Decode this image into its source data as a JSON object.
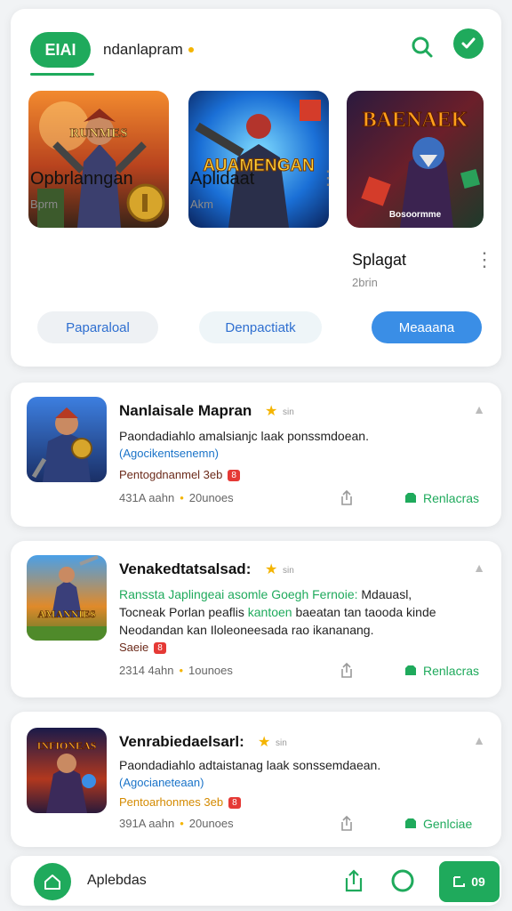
{
  "colors": {
    "accent": "#1faa5c",
    "blue": "#3a8ee6",
    "link": "#1a73c8",
    "star": "#f4b400",
    "badge": "#e53935"
  },
  "header": {
    "tab_label": "EIAI",
    "title": "ndanlapram"
  },
  "featured": [
    {
      "name": "Opbrlanngan",
      "size": "Bprm",
      "button": "Paparaloal",
      "art_text": "RUNMES"
    },
    {
      "name": "Aplidaat",
      "size": "Akm",
      "button": "Denpactiatk",
      "art_text": "AUAMENGAN"
    },
    {
      "name": "Splagat",
      "size": "2brin",
      "button": "Meaaana",
      "art_text": "BAENAEK",
      "art_subtext": "Bosoormme"
    }
  ],
  "list": [
    {
      "title": "Nanlaisale Mapran",
      "rating_small": "sin",
      "desc": "Paondadiahlo amalsianjc laak ponssmdoean.",
      "link": "(Agocikentsenemn)",
      "developer": "Pentogdnanmel 3eb",
      "badge": "8",
      "size": "431A aahn",
      "installs": "20unoes",
      "action": "Renlacras"
    },
    {
      "title": "Venakedtatsalsad:",
      "rating_small": "sin",
      "desc_line1_green": "Ranssta Japlingeai asomle Goegh Fernoie:",
      "desc_line1_rest": " Mdauasl,",
      "desc_line2_start": "Tocneak Porlan peaflis ",
      "desc_line2_green": "kantoen",
      "desc_line2_end": " baeatan tan taooda kinde",
      "desc_line3": "Neodandan kan Iloleoneesada rao ikananang.",
      "developer": "Saeie",
      "badge": "8",
      "size": "2314 4ahn",
      "installs": "1ounoes",
      "action": "Renlacras",
      "art_text": "AMANNIES"
    },
    {
      "title": "Venrabiedaelsarl:",
      "rating_small": "sin",
      "desc": "Paondadiahlo adtaistanag laak sonssemdaean.",
      "link": "(Agocianeteaan)",
      "developer": "Pentoarhonmes 3eb",
      "badge": "8",
      "size": "391A aahn",
      "installs": "20unoes",
      "action": "Genlciae",
      "art_text": "INFIONEAS"
    }
  ],
  "bottom": {
    "label": "Aplebdas",
    "action": "09"
  }
}
